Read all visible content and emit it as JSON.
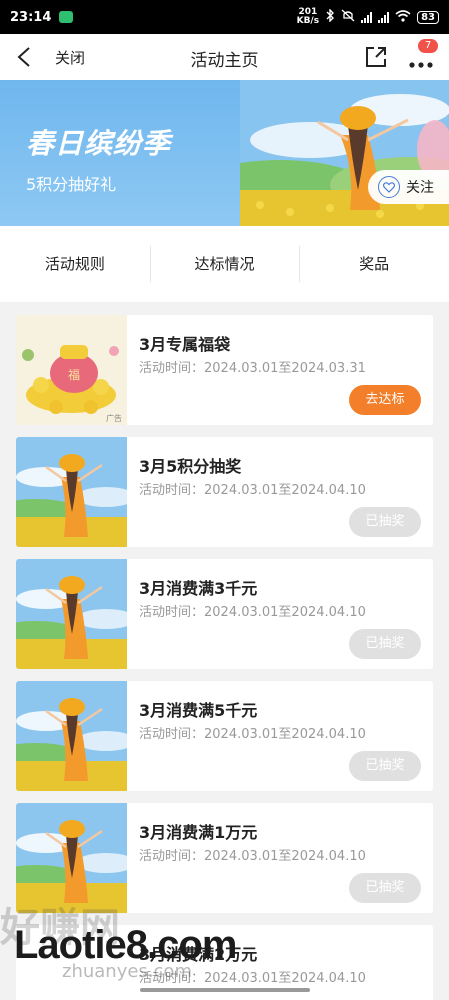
{
  "status_bar": {
    "time": "23:14",
    "speed_value": "201",
    "speed_unit": "KB/s",
    "battery": "83"
  },
  "nav": {
    "close_label": "关闭",
    "title": "活动主页",
    "badge_count": "7"
  },
  "banner": {
    "title": "春日缤纷季",
    "subtitle": "5积分抽好礼",
    "follow_label": "关注"
  },
  "tabs": [
    {
      "label": "活动规则"
    },
    {
      "label": "达标情况"
    },
    {
      "label": "奖品"
    }
  ],
  "cards": [
    {
      "title": "3月专属福袋",
      "time": "活动时间：2024.03.01至2024.03.31",
      "button": "去达标",
      "thumb_badge": "广告",
      "fu": "福"
    },
    {
      "title": "3月5积分抽奖",
      "time": "活动时间：2024.03.01至2024.04.10",
      "button": "已抽奖"
    },
    {
      "title": "3月消费满3千元",
      "time": "活动时间：2024.03.01至2024.04.10",
      "button": "已抽奖"
    },
    {
      "title": "3月消费满5千元",
      "time": "活动时间：2024.03.01至2024.04.10",
      "button": "已抽奖"
    },
    {
      "title": "3月消费满1万元",
      "time": "活动时间：2024.03.01至2024.04.10",
      "button": "已抽奖"
    },
    {
      "title": "3月消费满2万元",
      "time": "活动时间：2024.03.01至2024.04.10",
      "button": ""
    }
  ],
  "watermark": {
    "text": "Laotie8.com",
    "cn": "好赚网",
    "domain": "zhuanyes.com"
  },
  "colors": {
    "accent_orange": "#f47f2a",
    "badge_red": "#f0524a",
    "banner_blue": "#6fb7ee",
    "disabled_gray": "#e0e0e0"
  }
}
